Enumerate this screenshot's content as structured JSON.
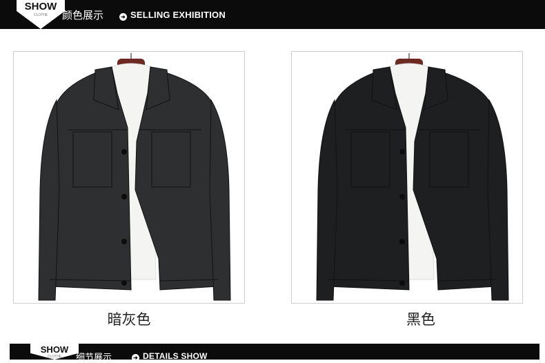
{
  "header": {
    "badge_main": "SHOW",
    "badge_sub": "CLOTHE",
    "title_zh": "颜色展示",
    "title_en": "SELLING EXHIBITION"
  },
  "products": [
    {
      "color_name": "暗灰色",
      "coat_color": "#2e2f31",
      "icon": "jacket-icon"
    },
    {
      "color_name": "黑色",
      "coat_color": "#1e1f21",
      "icon": "jacket-icon"
    }
  ],
  "footer_header": {
    "badge_main": "SHOW",
    "badge_sub": "CLOTHE",
    "title_zh": "细节展示",
    "title_en": "DETAILS SHOW"
  }
}
